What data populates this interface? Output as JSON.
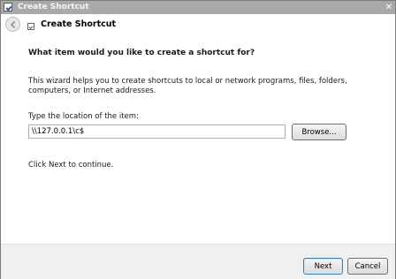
{
  "window": {
    "title": "Create Shortcut",
    "close_glyph": "✕",
    "icon": "shortcut-icon"
  },
  "header": {
    "title": "Create Shortcut",
    "back_icon": "back-arrow-icon"
  },
  "main": {
    "question": "What item would you like to create a shortcut for?",
    "description": "This wizard helps you to create shortcuts to local or network programs, files, folders, computers, or Internet addresses.",
    "location_label": "Type the location of the item:",
    "location_value": "\\\\127.0.0.1\\c$",
    "browse_label": "Browse...",
    "continue_note": "Click Next to continue."
  },
  "footer": {
    "next_label": "Next",
    "cancel_label": "Cancel"
  },
  "colors": {
    "titlebar": "#a9a9a9",
    "default_button_border": "#3c7fb1"
  }
}
